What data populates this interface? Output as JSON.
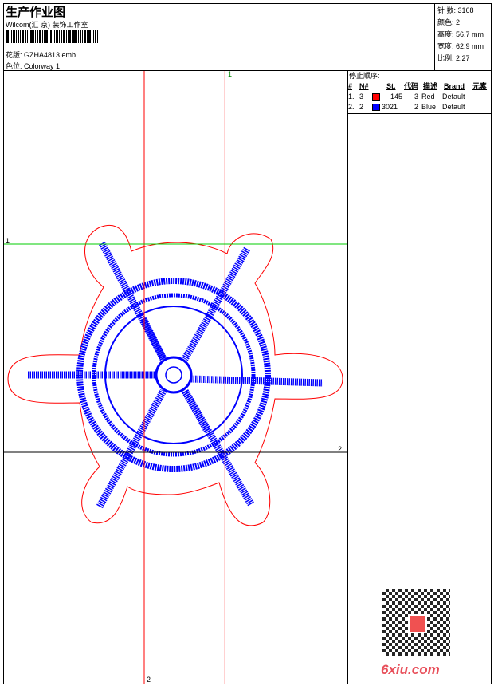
{
  "header": {
    "title": "生产作业图",
    "company": "Wilcom(汇 京) 装饰工作室",
    "design_label": "花版:",
    "design_file": "GZHA4813.emb",
    "colorway_label": "色位:",
    "colorway": "Colorway 1"
  },
  "stats": [
    {
      "label": "针 数:",
      "value": "3168"
    },
    {
      "label": "颜色:",
      "value": "2"
    },
    {
      "label": "高度:",
      "value": "56.7 mm"
    },
    {
      "label": "宽度:",
      "value": "62.9 mm"
    },
    {
      "label": "比例:",
      "value": "2.27"
    }
  ],
  "stop_sequence": {
    "title": "停止顺序:",
    "columns": [
      "#",
      "N#",
      "St.",
      "代码",
      "描述",
      "Brand",
      "元素"
    ],
    "rows": [
      {
        "idx": "1.",
        "n": "3",
        "color": "#ff0000",
        "st": "145",
        "code": "3",
        "desc": "Red",
        "brand": "Default"
      },
      {
        "idx": "2.",
        "n": "2",
        "color": "#0000ff",
        "st": "3021",
        "code": "2",
        "desc": "Blue",
        "brand": "Default"
      }
    ]
  },
  "guides": {
    "top": "1",
    "left": "1",
    "right": "2",
    "bottom": "2"
  },
  "watermark": "6xiu.com",
  "colors": {
    "outline": "#ff0000",
    "stitch": "#0000ff",
    "guide_green": "#00cc00"
  }
}
